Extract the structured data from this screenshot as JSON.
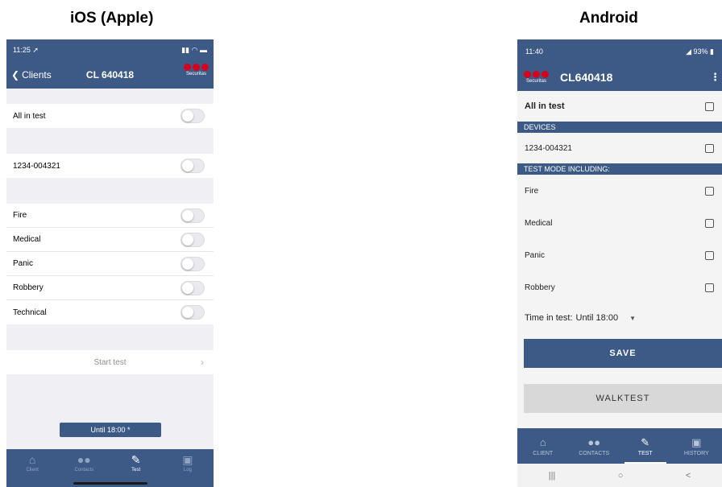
{
  "headings": {
    "ios": "iOS (Apple)",
    "android": "Android"
  },
  "colors": {
    "primary": "#3d5a86",
    "brand_red": "#d6001c"
  },
  "ios": {
    "status": {
      "time": "11:25",
      "location_icon": "location-arrow-icon",
      "signal_icon": "signal-icon",
      "wifi_icon": "wifi-icon",
      "battery_icon": "battery-icon"
    },
    "nav": {
      "back_label": "Clients",
      "title": "CL 640418",
      "logo_label": "Securitas"
    },
    "rows": {
      "all_in_test": "All in test",
      "device": "1234-004321",
      "fire": "Fire",
      "medical": "Medical",
      "panic": "Panic",
      "robbery": "Robbery",
      "technical": "Technical"
    },
    "start_test": "Start test",
    "until": "Until 18:00 *",
    "tabs": [
      {
        "label": "Client",
        "icon": "home-icon"
      },
      {
        "label": "Contacts",
        "icon": "contacts-icon"
      },
      {
        "label": "Test",
        "icon": "test-pen-icon",
        "active": true
      },
      {
        "label": "Log",
        "icon": "clipboard-icon"
      }
    ]
  },
  "android": {
    "status": {
      "time": "11:40",
      "battery": "93%"
    },
    "bar": {
      "logo_label": "Securitas",
      "title": "CL640418"
    },
    "all_in_test": "All in test",
    "devices_header": "DEVICES",
    "device": "1234-004321",
    "test_mode_header": "TEST MODE INCLUDING:",
    "items": [
      "Fire",
      "Medical",
      "Panic",
      "Robbery"
    ],
    "time_label": "Time in test:",
    "time_value": "Until 18:00",
    "save": "SAVE",
    "walktest": "WALKTEST",
    "tabs": [
      {
        "label": "CLIENT",
        "icon": "home-icon"
      },
      {
        "label": "CONTACTS",
        "icon": "contacts-icon"
      },
      {
        "label": "TEST",
        "icon": "test-pen-icon",
        "active": true
      },
      {
        "label": "HISTORY",
        "icon": "clipboard-icon"
      }
    ],
    "sysnav": {
      "recents": "|||",
      "home": "○",
      "back": "<"
    }
  }
}
